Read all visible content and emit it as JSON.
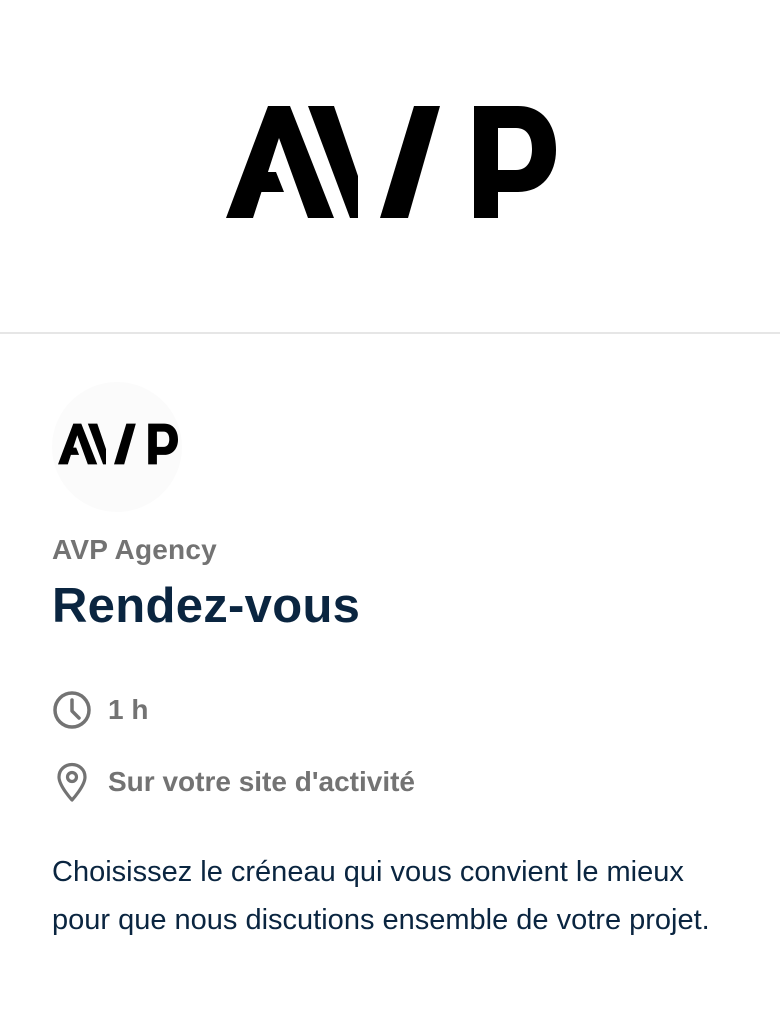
{
  "header": {
    "logo_text": "AVP",
    "logo_icon": "avp-logo"
  },
  "profile": {
    "avatar_text": "AVP",
    "organization": "AVP Agency"
  },
  "event": {
    "title": "Rendez-vous",
    "duration_icon": "clock-icon",
    "duration": "1 h",
    "location_icon": "map-pin-icon",
    "location": "Sur votre site d'activité",
    "description": "Choisissez le créneau qui vous convient le mieux pour que nous discutions ensemble de votre projet."
  },
  "colors": {
    "title": "#0a2540",
    "muted": "#737373",
    "divider": "#e6e6e6"
  }
}
